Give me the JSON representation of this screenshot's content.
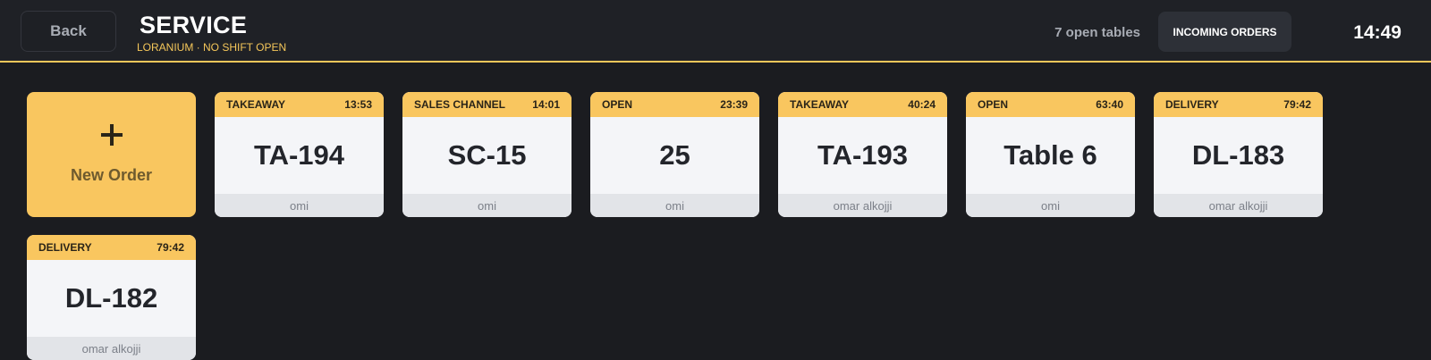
{
  "header": {
    "back_label": "Back",
    "title": "SERVICE",
    "subtitle": "LORANIUM · NO SHIFT OPEN",
    "open_tables": "7 open tables",
    "incoming_label": "INCOMING ORDERS",
    "clock": "14:49"
  },
  "new_order": {
    "icon": "plus-icon",
    "label": "New Order"
  },
  "orders": [
    {
      "type": "TAKEAWAY",
      "time": "13:53",
      "name": "TA-194",
      "staff": "omi"
    },
    {
      "type": "SALES CHANNEL",
      "time": "14:01",
      "name": "SC-15",
      "staff": "omi"
    },
    {
      "type": "OPEN",
      "time": "23:39",
      "name": "25",
      "staff": "omi"
    },
    {
      "type": "TAKEAWAY",
      "time": "40:24",
      "name": "TA-193",
      "staff": "omar alkojji"
    },
    {
      "type": "OPEN",
      "time": "63:40",
      "name": "Table 6",
      "staff": "omi"
    },
    {
      "type": "DELIVERY",
      "time": "79:42",
      "name": "DL-183",
      "staff": "omar alkojji"
    },
    {
      "type": "DELIVERY",
      "time": "79:42",
      "name": "DL-182",
      "staff": "omar alkojji"
    }
  ],
  "colors": {
    "background": "#1b1c20",
    "accent": "#f9c65f",
    "card_body": "#f4f5f8",
    "card_footer": "#e2e4e8"
  }
}
